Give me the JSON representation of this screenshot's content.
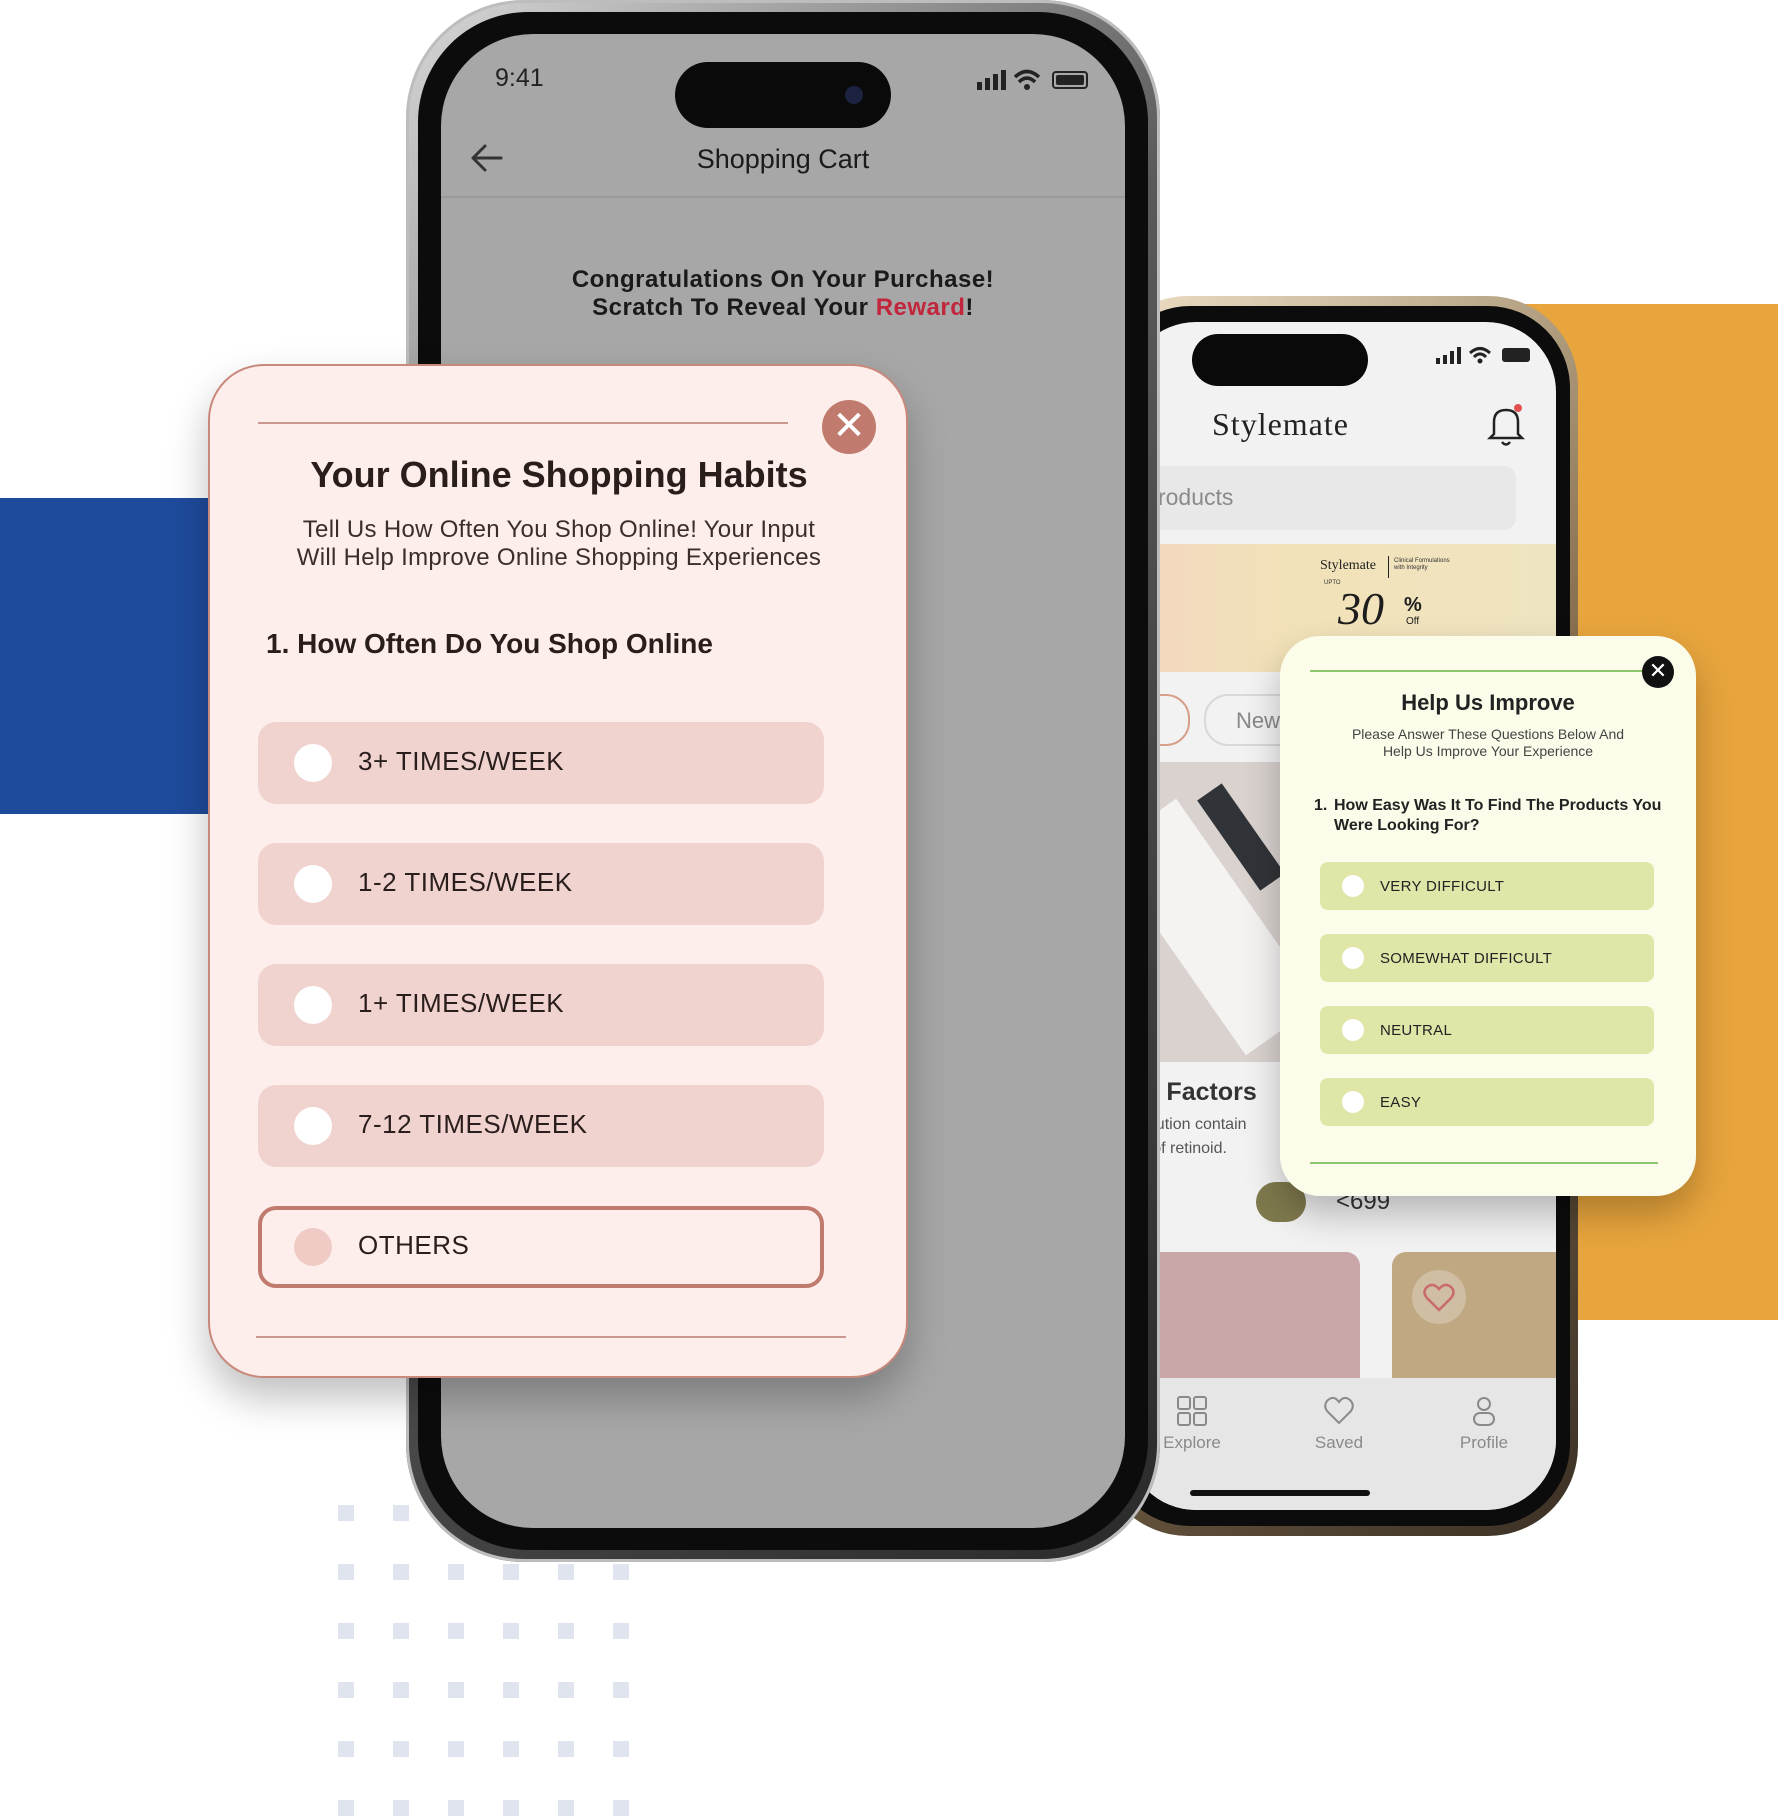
{
  "phone_back": {
    "status_time": "9:41",
    "header_title": "Shopping Cart",
    "back_icon": "arrow-left-icon",
    "congrats_line1": "Congratulations On Your Purchase!",
    "congrats_line2_prefix": "Scratch To Reveal Your ",
    "congrats_line2_highlight": "Reward",
    "congrats_line2_suffix": "!",
    "highlight_color": "#c2263c"
  },
  "phone_front": {
    "brand": "Stylemate",
    "search_placeholder_fragment": "h products",
    "banner_brand": "Stylemate",
    "banner_tagline": "Clinical Formulations with Integrity",
    "banner_upto": "UPTO",
    "banner_value": "30",
    "banner_percent": "%",
    "banner_off": "Off",
    "chip_fragment": "New",
    "product_title_fragment": "ing Factors",
    "product_desc_line1": "e solution contain",
    "product_desc_line2": "tion of retinoid.",
    "price_fragment": "<699",
    "nav": [
      {
        "label": "Explore",
        "icon": "grid-icon"
      },
      {
        "label": "Saved",
        "icon": "heart-icon"
      },
      {
        "label": "Profile",
        "icon": "user-icon"
      }
    ]
  },
  "survey_habits": {
    "title": "Your Online Shopping Habits",
    "subtitle_line1": "Tell Us How Often You Shop Online! Your Input",
    "subtitle_line2": "Will Help Improve Online Shopping Experiences",
    "question": "1. How Often Do You Shop Online",
    "options": [
      "3+ TIMES/WEEK",
      "1-2 TIMES/WEEK",
      "1+ TIMES/WEEK",
      "7-12 TIMES/WEEK",
      "OTHERS"
    ],
    "selected_option": "OTHERS",
    "close_icon": "close-icon",
    "accent_color": "#c07b6e"
  },
  "survey_improve": {
    "title": "Help Us Improve",
    "subtitle_line1": "Please Answer These Questions Below And",
    "subtitle_line2": "Help Us Improve Your Experience",
    "question_number": "1.",
    "question_text": "How Easy Was It To Find The Products You Were Looking For?",
    "options": [
      "VERY DIFFICULT",
      "SOMEWHAT DIFFICULT",
      "NEUTRAL",
      "EASY"
    ],
    "close_icon": "close-icon",
    "accent_color": "#8dc56b"
  },
  "decor": {
    "blue": "#1f4b9c",
    "orange": "#e8a53d"
  }
}
